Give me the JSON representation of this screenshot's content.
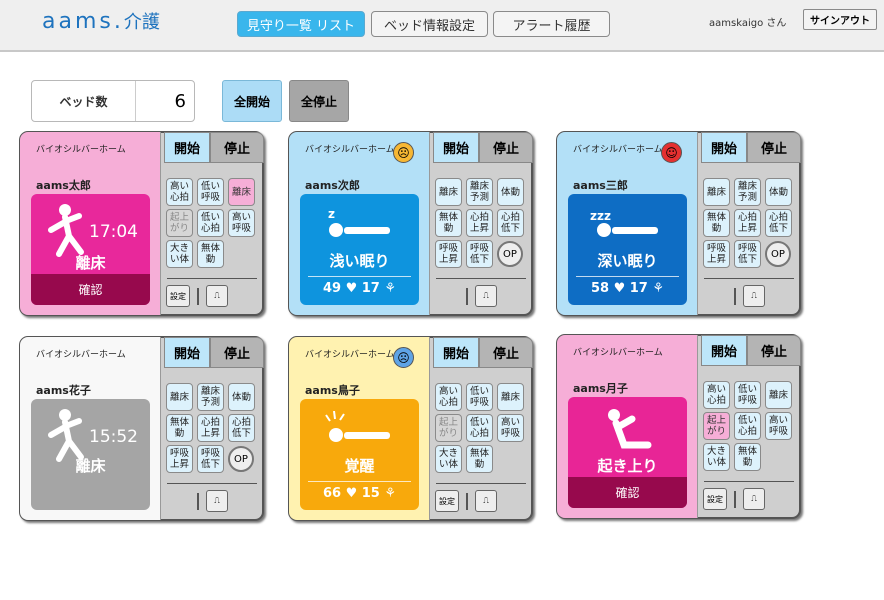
{
  "header": {
    "logo_main": "aams.",
    "logo_kanji": "介護",
    "nav": [
      "見守り一覧 リスト",
      "ベッド情報設定",
      "アラート履歴"
    ],
    "user": "aamskaigo さん",
    "signout": "サインアウト"
  },
  "controls": {
    "bed_count_label": "ベッド数",
    "bed_count": "6",
    "start_all": "全開始",
    "stop_all": "全停止"
  },
  "tabs": {
    "start": "開始",
    "stop": "停止"
  },
  "settings_label": "設定",
  "op_label": "OP",
  "cards": [
    {
      "facility": "バイオシルバーホーム",
      "name": "aams太郎",
      "theme": "pink",
      "face": "",
      "state": "離床",
      "time": "17:04",
      "confirm": "確認",
      "heart": "",
      "breath": "",
      "alerts": [
        "高い\n心拍",
        "低い\n呼吸",
        "離床",
        "起上\nがり",
        "低い\n心拍",
        "高い\n呼吸",
        "大き\nい体",
        "無体\n動"
      ]
    },
    {
      "facility": "バイオシルバーホーム",
      "name": "aams次郎",
      "theme": "blue",
      "face": "neutral",
      "state": "浅い眠り",
      "time": "",
      "confirm": "",
      "heart": "49",
      "breath": "17",
      "alerts": [
        "離床",
        "離床\n予測",
        "体動",
        "無体\n動",
        "心拍\n上昇",
        "心拍\n低下",
        "呼吸\n上昇",
        "呼吸\n低下"
      ]
    },
    {
      "facility": "バイオシルバーホーム",
      "name": "aams三郎",
      "theme": "blue",
      "face": "happy",
      "state": "深い眠り",
      "time": "",
      "confirm": "",
      "heart": "58",
      "breath": "17",
      "alerts": [
        "離床",
        "離床\n予測",
        "体動",
        "無体\n動",
        "心拍\n上昇",
        "心拍\n低下",
        "呼吸\n上昇",
        "呼吸\n低下"
      ]
    },
    {
      "facility": "バイオシルバーホーム",
      "name": "aams花子",
      "theme": "white",
      "face": "",
      "state": "離床",
      "time": "15:52",
      "confirm": "",
      "heart": "",
      "breath": "",
      "alerts": [
        "離床",
        "離床\n予測",
        "体動",
        "無体\n動",
        "心拍\n上昇",
        "心拍\n低下",
        "呼吸\n上昇",
        "呼吸\n低下"
      ]
    },
    {
      "facility": "バイオシルバーホーム",
      "name": "aams鳥子",
      "theme": "yellow",
      "face": "sad",
      "state": "覚醒",
      "time": "",
      "confirm": "",
      "heart": "66",
      "breath": "15",
      "alerts": [
        "高い\n心拍",
        "低い\n呼吸",
        "離床",
        "起上\nがり",
        "低い\n心拍",
        "高い\n呼吸",
        "大き\nい体",
        "無体\n動"
      ]
    },
    {
      "facility": "バイオシルバーホーム",
      "name": "aams月子",
      "theme": "pink",
      "face": "",
      "state": "起き上り",
      "time": "",
      "confirm": "確認",
      "heart": "",
      "breath": "",
      "alerts": [
        "高い\n心拍",
        "低い\n呼吸",
        "離床",
        "起上\nがり",
        "低い\n心拍",
        "高い\n呼吸",
        "大き\nい体",
        "無体\n動"
      ]
    }
  ],
  "colors": {
    "accent": "#39b6ec",
    "alarm_pink": "#e8289b",
    "confirm": "#97094d",
    "light_sleep": "#0e94de",
    "deep_sleep": "#0e6dc4",
    "awake": "#f8a90c"
  }
}
